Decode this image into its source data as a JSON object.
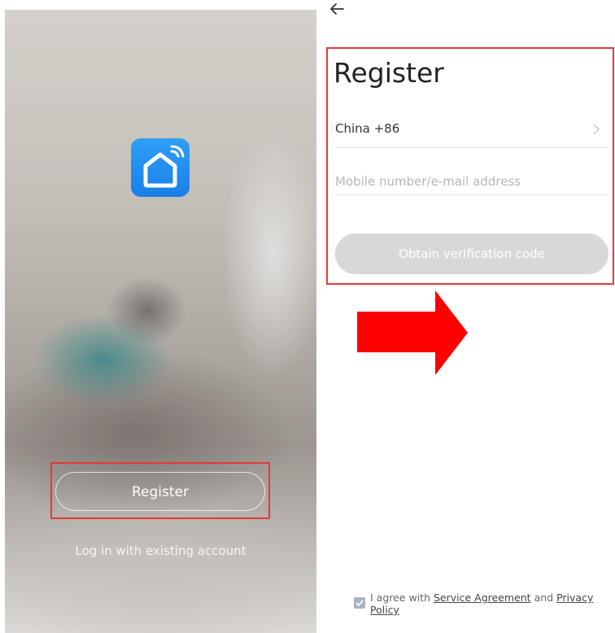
{
  "splash": {
    "logo_icon": "smart-home-wifi-icon",
    "register_label": "Register",
    "login_label": "Log in with existing account"
  },
  "register_page": {
    "back_icon": "arrow-left-icon",
    "title": "Register",
    "country_label": "China +86",
    "country_chevron_icon": "chevron-right-icon",
    "mobile_placeholder": "Mobile number/e-mail address",
    "mobile_value": "",
    "obtain_label": "Obtain verification code",
    "agreement": {
      "checkbox_checked": true,
      "prefix": "I agree with",
      "service_agreement": "Service Agreement",
      "and": "and",
      "privacy_policy": "Privacy Policy"
    }
  },
  "colors": {
    "highlight_box": "#e53935",
    "arrow": "#ff0000",
    "logo_blue": "#1a7fe8",
    "disabled_button": "#d8d8d8"
  }
}
